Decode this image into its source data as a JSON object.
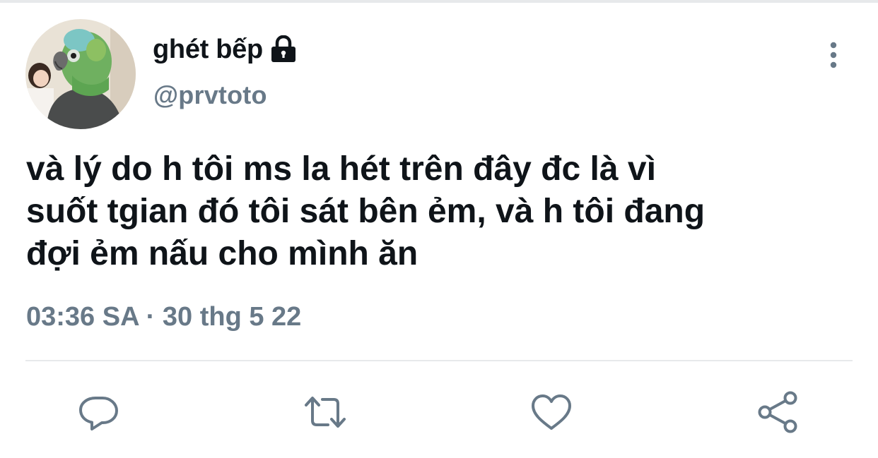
{
  "tweet": {
    "display_name": "ghét bếp",
    "handle": "@prvtoto",
    "text": "và lý do h tôi ms la hét trên đây đc là vì\nsuốt tgian đó tôi sát bên ẻm, và h tôi đang\nđợi ẻm nấu cho mình ăn",
    "timestamp": "03:36 SA · 30 thg 5 22"
  },
  "icons": {
    "protected": "lock-icon",
    "menu": "more-vertical-icon",
    "reply": "reply-bubble-icon",
    "retweet": "retweet-arrows-icon",
    "like": "heart-icon",
    "share": "share-icon"
  },
  "colors": {
    "text_primary": "#0f1419",
    "text_secondary": "#687988",
    "icon": "#687988",
    "divider": "#e7e9eb"
  }
}
